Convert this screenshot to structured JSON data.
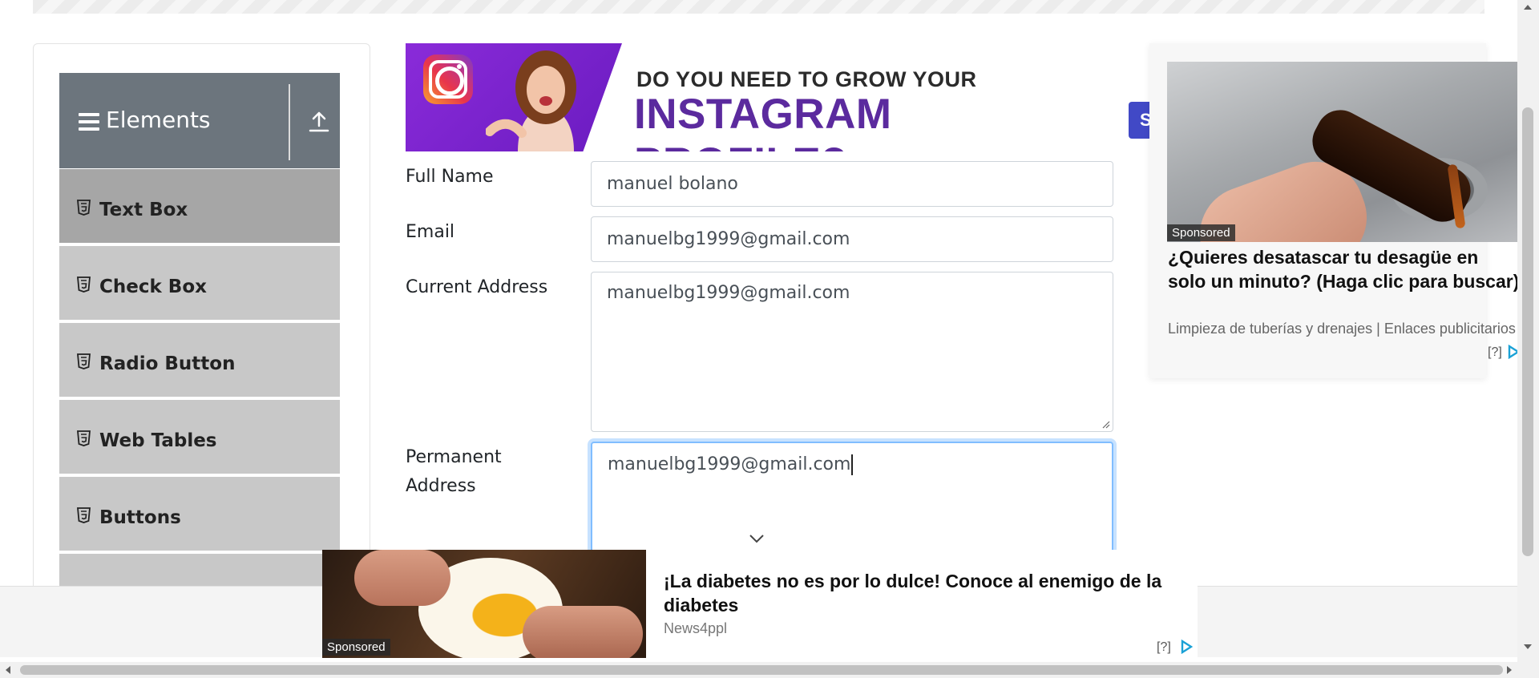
{
  "sidebar": {
    "group_title": "Elements",
    "items": [
      {
        "label": "Text Box",
        "active": true
      },
      {
        "label": "Check Box",
        "active": false
      },
      {
        "label": "Radio Button",
        "active": false
      },
      {
        "label": "Web Tables",
        "active": false
      },
      {
        "label": "Buttons",
        "active": false
      }
    ]
  },
  "banner": {
    "line1": "DO YOU NEED TO GROW YOUR",
    "line2": "INSTAGRAM PROFILE?",
    "brand_color": "#5b2a9e"
  },
  "peek_button": {
    "label": "S"
  },
  "form": {
    "full_name_label": "Full Name",
    "full_name_value": "manuel bolano",
    "email_label": "Email",
    "email_value": "manuelbg1999@gmail.com",
    "current_address_label": "Current Address",
    "current_address_value": "manuelbg1999@gmail.com",
    "permanent_address_label_line1": "Permanent",
    "permanent_address_label_line2": "Address",
    "permanent_address_value": "manuelbg1999@gmail.com"
  },
  "right_ad": {
    "badge": "Sponsored",
    "title": "¿Quieres desatascar tu desagüe en solo un minuto? (Haga clic para buscar)",
    "source": "Limpieza de tuberías y drenajes | Enlaces publicitarios",
    "help": "[?]"
  },
  "bottom_ad": {
    "badge": "Sponsored",
    "title": "¡La diabetes no es por lo dulce! Conoce al enemigo de la diabetes",
    "source": "News4ppl",
    "help": "[?]"
  },
  "colors": {
    "sidebar_header": "#6c757d",
    "menu_item": "#c8c8c8",
    "menu_item_active": "#a6a6a6",
    "focus_border": "#80bdff",
    "adchoices": "#1aa1d6"
  }
}
